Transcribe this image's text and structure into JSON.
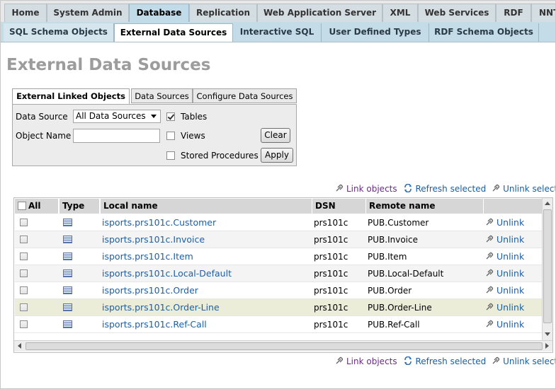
{
  "top_tabs": [
    "Home",
    "System Admin",
    "Database",
    "Replication",
    "Web Application Server",
    "XML",
    "Web Services",
    "RDF",
    "NNT"
  ],
  "active_top_tab": "Database",
  "sub_tabs": [
    "SQL Schema Objects",
    "External Data Sources",
    "Interactive SQL",
    "User Defined Types",
    "RDF Schema Objects"
  ],
  "active_sub_tab": "External Data Sources",
  "page_title": "External Data Sources",
  "inner_tabs": [
    "External Linked Objects",
    "Data Sources",
    "Configure Data Sources"
  ],
  "active_inner_tab": "External Linked Objects",
  "filter": {
    "data_source_label": "Data Source",
    "data_source_value": "All Data Sources",
    "object_name_label": "Object Name",
    "object_name_value": "",
    "tables_label": "Tables",
    "tables_checked": true,
    "views_label": "Views",
    "views_checked": false,
    "stored_procedures_label": "Stored Procedures",
    "stored_procedures_checked": false,
    "clear_label": "Clear",
    "apply_label": "Apply"
  },
  "actions": {
    "link_objects": "Link objects",
    "refresh_selected": "Refresh selected",
    "unlink_selected": "Unlink selected"
  },
  "table": {
    "headers": {
      "all": "All",
      "type": "Type",
      "local_name": "Local name",
      "dsn": "DSN",
      "remote_name": "Remote name"
    },
    "unlink_label": "Unlink",
    "rows": [
      {
        "local_name": "isports.prs101c.Customer",
        "dsn": "prs101c",
        "remote_name": "PUB.Customer"
      },
      {
        "local_name": "isports.prs101c.Invoice",
        "dsn": "prs101c",
        "remote_name": "PUB.Invoice"
      },
      {
        "local_name": "isports.prs101c.Item",
        "dsn": "prs101c",
        "remote_name": "PUB.Item"
      },
      {
        "local_name": "isports.prs101c.Local-Default",
        "dsn": "prs101c",
        "remote_name": "PUB.Local-Default"
      },
      {
        "local_name": "isports.prs101c.Order",
        "dsn": "prs101c",
        "remote_name": "PUB.Order"
      },
      {
        "local_name": "isports.prs101c.Order-Line",
        "dsn": "prs101c",
        "remote_name": "PUB.Order-Line"
      },
      {
        "local_name": "isports.prs101c.Ref-Call",
        "dsn": "prs101c",
        "remote_name": "PUB.Ref-Call"
      }
    ],
    "highlighted_row": 5
  },
  "colors": {
    "link": "#1d5fa6",
    "title": "#9c9c9c",
    "highlight_row": "#ebedd9"
  }
}
